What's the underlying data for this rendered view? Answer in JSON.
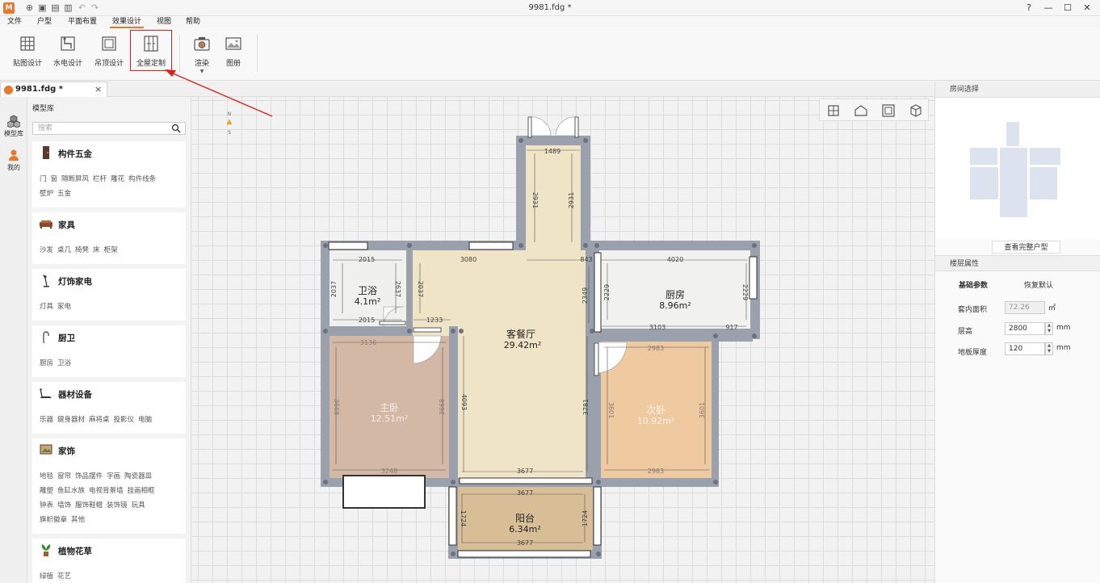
{
  "app": {
    "logo": "M",
    "title": "9981.fdg *"
  },
  "colors": {
    "accent": "#e8782c",
    "highlight": "#e02020"
  },
  "quick_access": [
    "new-icon",
    "open-icon",
    "save-icon",
    "save-as-icon",
    "undo-icon",
    "redo-icon"
  ],
  "window_controls": [
    "help-icon",
    "minimize-icon",
    "maximize-icon",
    "close-icon"
  ],
  "menu": [
    "文件",
    "户型",
    "平面布置",
    "效果设计",
    "视图",
    "帮助"
  ],
  "ribbon": {
    "buttons": [
      "贴图设计",
      "水电设计",
      "吊顶设计",
      "全屋定制",
      "渲染",
      "图册"
    ]
  },
  "doc_tab": {
    "label": "9981.fdg *",
    "close": "×"
  },
  "rail": [
    "模型库",
    "我的"
  ],
  "library": {
    "title": "模型库",
    "search_placeholder": "搜索",
    "categories": [
      {
        "name": "构件五金",
        "icon": "door-icon",
        "tags": [
          "门",
          "窗",
          "隔断屏风",
          "栏杆",
          "雕花",
          "构件线条",
          "壁炉",
          "五金"
        ]
      },
      {
        "name": "家具",
        "icon": "sofa-icon",
        "tags": [
          "沙发",
          "桌几",
          "椅凳",
          "床",
          "柜架"
        ]
      },
      {
        "name": "灯饰家电",
        "icon": "lamp-icon",
        "tags": [
          "灯具",
          "家电"
        ]
      },
      {
        "name": "厨卫",
        "icon": "faucet-icon",
        "tags": [
          "厨房",
          "卫浴"
        ]
      },
      {
        "name": "器材设备",
        "icon": "treadmill-icon",
        "tags": [
          "乐器",
          "健身器材",
          "麻将桌",
          "投影仪",
          "电脑"
        ]
      },
      {
        "name": "家饰",
        "icon": "decor-icon",
        "tags": [
          "地毯",
          "窗帘",
          "饰品摆件",
          "字画",
          "陶瓷器皿",
          "雕塑",
          "鱼缸水族",
          "电视背景墙",
          "挂画相框",
          "钟表",
          "墙饰",
          "服饰鞋帽",
          "装饰镜",
          "玩具",
          "旗帜徽章",
          "其他"
        ]
      },
      {
        "name": "植物花草",
        "icon": "plant-icon",
        "tags": [
          "绿植",
          "花艺"
        ]
      }
    ]
  },
  "compass": {
    "n": "N",
    "s": "S"
  },
  "floorplan": {
    "rooms": [
      {
        "name": "卫浴",
        "area": "4.1m²"
      },
      {
        "name": "厨房",
        "area": "8.96m²"
      },
      {
        "name": "客餐厅",
        "area": "29.42m²"
      },
      {
        "name": "主卧",
        "area": "12.51m²"
      },
      {
        "name": "次卧",
        "area": "10.92m²"
      },
      {
        "name": "阳台",
        "area": "6.34m²"
      }
    ],
    "dimensions": [
      "1489",
      "2931",
      "2931",
      "2015",
      "3080",
      "843",
      "4020",
      "2037",
      "2637",
      "2037",
      "2349",
      "2229",
      "2229",
      "2015",
      "1233",
      "3103",
      "917",
      "3136",
      "2983",
      "4093",
      "3781",
      "3668",
      "3668",
      "3601",
      "3601",
      "3248",
      "3677",
      "2983",
      "3677",
      "1724",
      "1724",
      "3677"
    ]
  },
  "view_toolbar": [
    "2d-plan-icon",
    "3d-house-icon",
    "top-view-icon",
    "cube-view-icon"
  ],
  "right_panel": {
    "room_select_title": "房间选择",
    "view_full_button": "查看完整户型",
    "floor_props_title": "楼层属性",
    "tabs": [
      "基础参数",
      "恢复默认"
    ],
    "fields": [
      {
        "label": "套内面积",
        "value": "72.26",
        "unit": "㎡"
      },
      {
        "label": "层高",
        "value": "2800",
        "unit": "mm"
      },
      {
        "label": "地板厚度",
        "value": "120",
        "unit": "mm"
      }
    ]
  }
}
